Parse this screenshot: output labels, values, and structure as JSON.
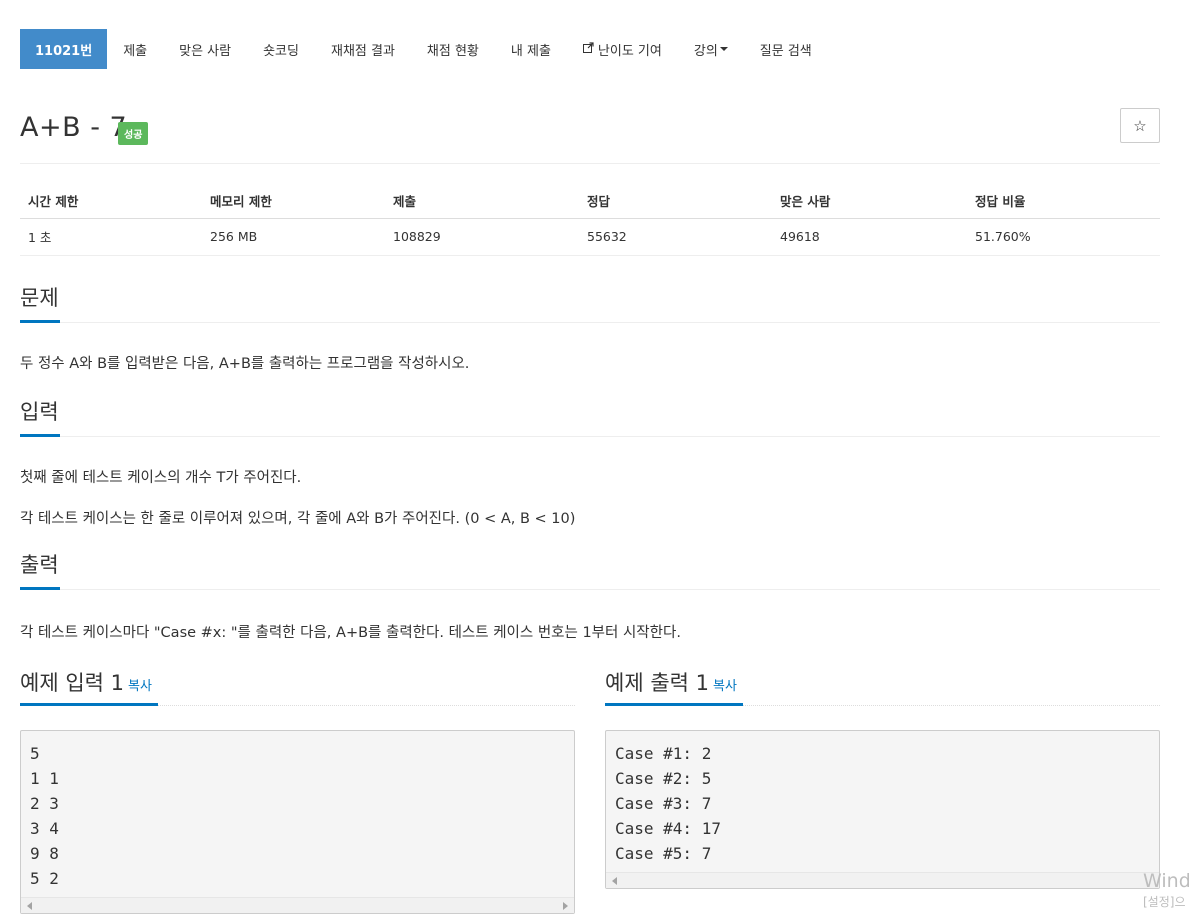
{
  "nav": {
    "items": [
      {
        "label": "11021번"
      },
      {
        "label": "제출"
      },
      {
        "label": "맞은 사람"
      },
      {
        "label": "숏코딩"
      },
      {
        "label": "재채점 결과"
      },
      {
        "label": "채점 현황"
      },
      {
        "label": "내 제출"
      },
      {
        "label": "난이도 기여",
        "icon": "external-link-icon"
      },
      {
        "label": "강의",
        "icon": "caret-down-icon"
      },
      {
        "label": "질문 검색"
      }
    ]
  },
  "problem": {
    "title": "A+B - 7",
    "badge": "성공",
    "star_icon": "☆"
  },
  "info_table": {
    "headers": [
      "시간 제한",
      "메모리 제한",
      "제출",
      "정답",
      "맞은 사람",
      "정답 비율"
    ],
    "values": [
      "1 초",
      "256 MB",
      "108829",
      "55632",
      "49618",
      "51.760%"
    ]
  },
  "sections": {
    "problem": {
      "heading": "문제",
      "text": "두 정수 A와 B를 입력받은 다음, A+B를 출력하는 프로그램을 작성하시오."
    },
    "input": {
      "heading": "입력",
      "line1": "첫째 줄에 테스트 케이스의 개수 T가 주어진다.",
      "line2": "각 테스트 케이스는 한 줄로 이루어져 있으며, 각 줄에 A와 B가 주어진다. (0 < A, B < 10)"
    },
    "output": {
      "heading": "출력",
      "text": "각 테스트 케이스마다 \"Case #x: \"를 출력한 다음, A+B를 출력한다. 테스트 케이스 번호는 1부터 시작한다."
    }
  },
  "examples": {
    "input": {
      "heading": "예제 입력 1",
      "copy_label": "복사",
      "lines": [
        "5",
        "1 1",
        "2 3",
        "3 4",
        "9 8",
        "5 2"
      ]
    },
    "output": {
      "heading": "예제 출력 1",
      "copy_label": "복사",
      "lines": [
        "Case #1: 2",
        "Case #2: 5",
        "Case #3: 7",
        "Case #4: 17",
        "Case #5: 7"
      ]
    }
  },
  "watermark": {
    "line1": "Wind",
    "line2": "[설정]으"
  },
  "colors": {
    "accent": "#428bca",
    "link": "#0076c0",
    "success": "#5cb85c"
  }
}
